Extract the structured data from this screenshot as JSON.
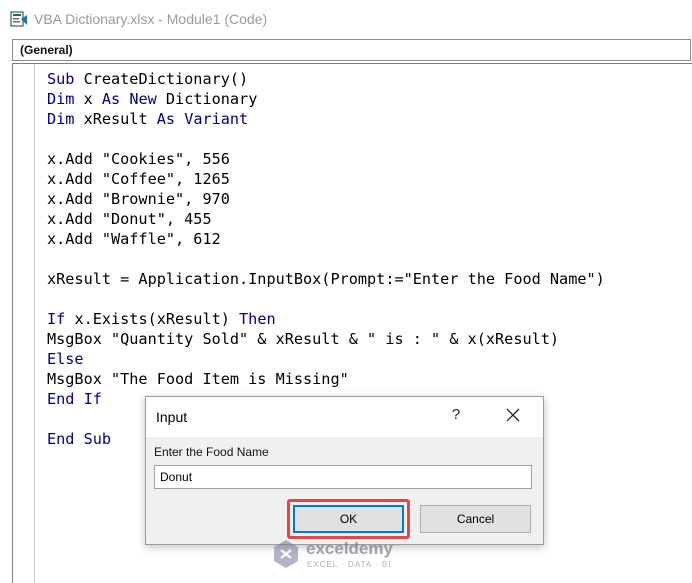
{
  "window": {
    "title": "VBA Dictionary.xlsx - Module1 (Code)"
  },
  "procedure_combo": {
    "value": "(General)"
  },
  "code": {
    "lines": [
      [
        {
          "t": "Sub",
          "k": 1
        },
        {
          "t": " CreateDictionary()"
        }
      ],
      [
        {
          "t": "Dim",
          "k": 1
        },
        {
          "t": " x "
        },
        {
          "t": "As",
          "k": 1
        },
        {
          "t": " "
        },
        {
          "t": "New",
          "k": 1
        },
        {
          "t": " Dictionary"
        }
      ],
      [
        {
          "t": "Dim",
          "k": 1
        },
        {
          "t": " xResult "
        },
        {
          "t": "As",
          "k": 1
        },
        {
          "t": " "
        },
        {
          "t": "Variant",
          "k": 1
        }
      ],
      [],
      [
        {
          "t": "x.Add \"Cookies\", 556"
        }
      ],
      [
        {
          "t": "x.Add \"Coffee\", 1265"
        }
      ],
      [
        {
          "t": "x.Add \"Brownie\", 970"
        }
      ],
      [
        {
          "t": "x.Add \"Donut\", 455"
        }
      ],
      [
        {
          "t": "x.Add \"Waffle\", 612"
        }
      ],
      [],
      [
        {
          "t": "xResult = Application.InputBox(Prompt:=\"Enter the Food Name\")"
        }
      ],
      [],
      [
        {
          "t": "If",
          "k": 1
        },
        {
          "t": " x.Exists(xResult) "
        },
        {
          "t": "Then",
          "k": 1
        }
      ],
      [
        {
          "t": "MsgBox \"Quantity Sold\" & xResult & \" is : \" & x(xResult)"
        }
      ],
      [
        {
          "t": "Else",
          "k": 1
        }
      ],
      [
        {
          "t": "MsgBox \"The Food Item is Missing\""
        }
      ],
      [
        {
          "t": "End If",
          "k": 1
        }
      ],
      [],
      [
        {
          "t": "End Sub",
          "k": 1
        }
      ]
    ]
  },
  "dialog": {
    "title": "Input",
    "help_label": "?",
    "prompt": "Enter the Food Name",
    "input_value": "Donut",
    "ok_label": "OK",
    "cancel_label": "Cancel"
  },
  "watermark": {
    "name": "exceldemy",
    "tagline": "EXCEL · DATA · BI"
  },
  "colors": {
    "keyword": "#00008b",
    "highlight": "#e0464b",
    "focus": "#0078d7"
  }
}
